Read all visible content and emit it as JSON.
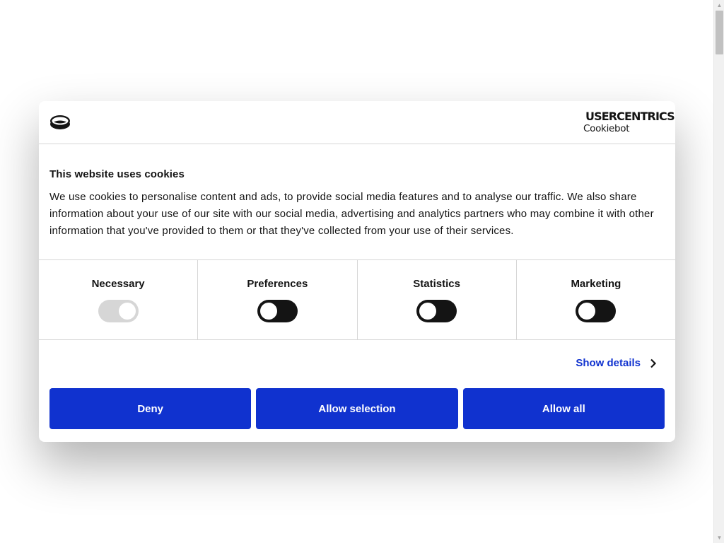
{
  "dialog": {
    "title": "This website uses cookies",
    "description": "We use cookies to personalise content and ads, to provide social media features and to analyse our traffic. We also share information about your use of our site with our social media, advertising and analytics partners who may combine it with other information that you've provided to them or that they've collected from your use of their services."
  },
  "brand": {
    "name": "USERCENTRICS",
    "product": "Cookiebot"
  },
  "categories": [
    {
      "label": "Necessary",
      "enabled": true,
      "locked": true
    },
    {
      "label": "Preferences",
      "enabled": false,
      "locked": false
    },
    {
      "label": "Statistics",
      "enabled": false,
      "locked": false
    },
    {
      "label": "Marketing",
      "enabled": false,
      "locked": false
    }
  ],
  "details": {
    "label": "Show details",
    "icon": "chevron-right-icon"
  },
  "buttons": {
    "deny": "Deny",
    "allow_selection": "Allow selection",
    "allow_all": "Allow all"
  },
  "colors": {
    "accent": "#1032cf",
    "toggle_off": "#141414",
    "toggle_locked": "#d6d6d6",
    "text": "#141414"
  }
}
